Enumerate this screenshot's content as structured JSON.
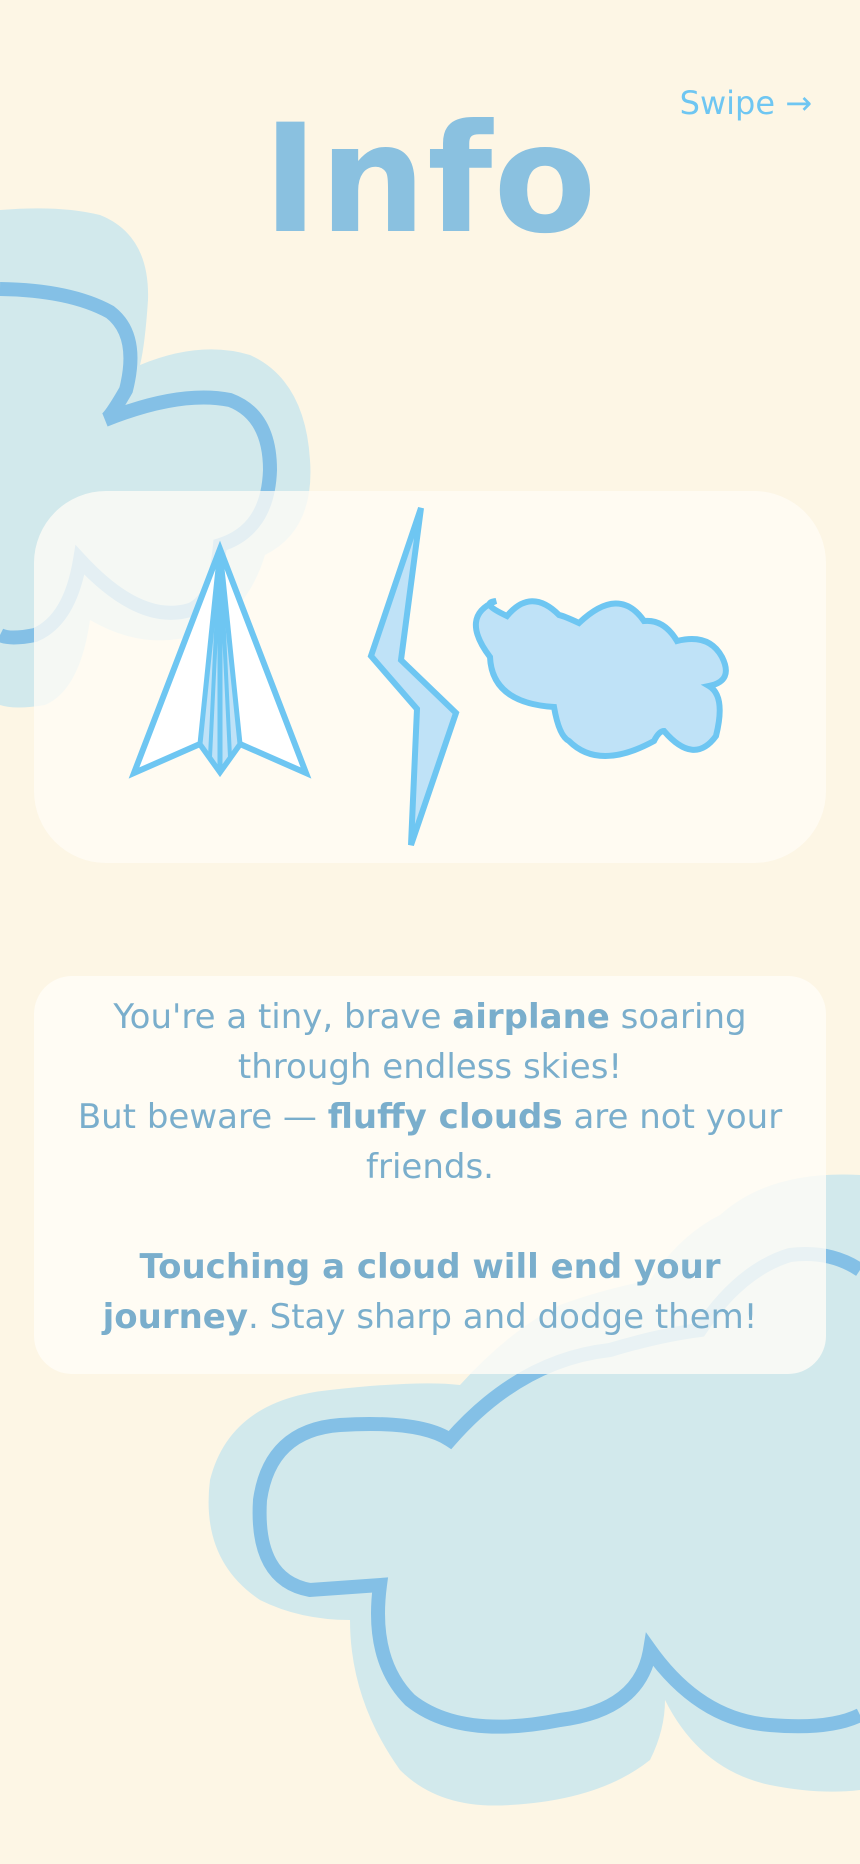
{
  "header": {
    "title": "Info",
    "swipe_label": "Swipe →"
  },
  "icons": {
    "items": [
      {
        "name": "paper-airplane-icon"
      },
      {
        "name": "lightning-bolt-icon"
      },
      {
        "name": "cloud-icon"
      }
    ]
  },
  "intro": {
    "part1": "You're a tiny, brave ",
    "part1_bold": "airplane",
    "part2": " soaring through endless skies!",
    "part3": "But beware — ",
    "part3_bold": "fluffy clouds",
    "part4": " are not your friends."
  },
  "warning": {
    "bold": "Touching a cloud will end your journey",
    "rest": ". Stay sharp and dodge them!"
  },
  "colors": {
    "background": "#fdf6e5",
    "accent": "#6ec6f2",
    "text": "#7aaecc",
    "cloud_fill": "#d2e9ec",
    "cloud_outline": "#84c0e6"
  }
}
